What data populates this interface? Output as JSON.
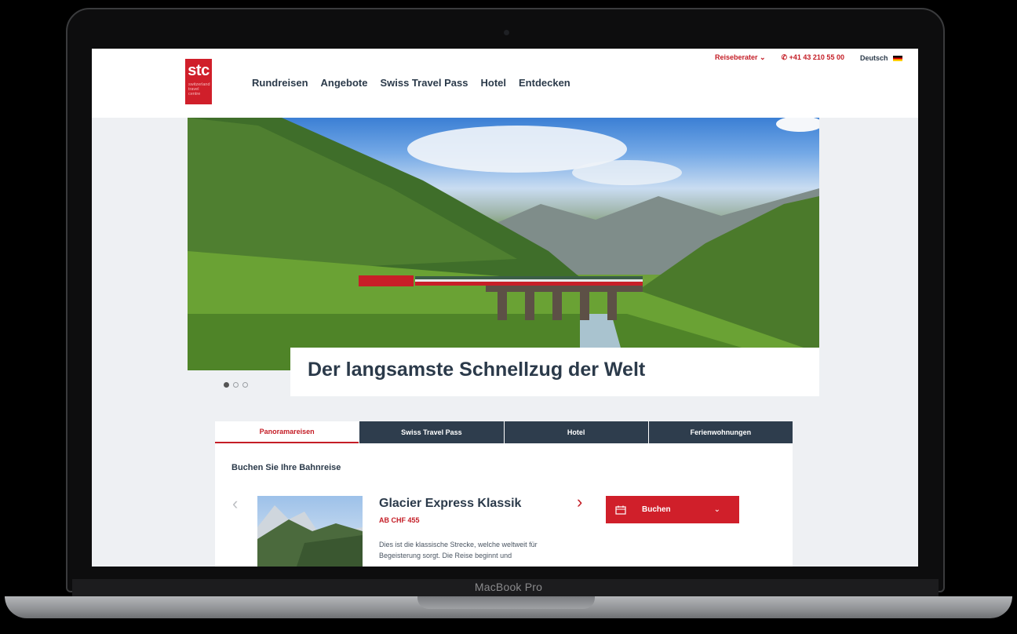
{
  "device": {
    "label": "MacBook Pro"
  },
  "header": {
    "logo": {
      "text": "stc",
      "sub": "switzerland travel centre"
    },
    "nav": [
      "Rundreisen",
      "Angebote",
      "Swiss Travel Pass",
      "Hotel",
      "Entdecken"
    ],
    "advisor": "Reiseberater",
    "phone": "+41 43 210 55 00",
    "language": "Deutsch"
  },
  "hero": {
    "caption": "Der langsamste Schnellzug der Welt",
    "slides": 3,
    "active_slide": 1
  },
  "booking": {
    "tabs": [
      "Panoramareisen",
      "Swiss Travel Pass",
      "Hotel",
      "Ferienwohnungen"
    ],
    "active_tab": "Panoramareisen",
    "heading": "Buchen Sie Ihre Bahnreise",
    "product": {
      "title": "Glacier Express Klassik",
      "price": "AB CHF 455",
      "description": "Dies ist die klassische Strecke, welche weltweit für Begeisterung sorgt. Die Reise beginnt und"
    },
    "book_button": "Buchen"
  },
  "colors": {
    "brand_red": "#d01f2a",
    "nav_dark": "#2e3d4d",
    "text_dark": "#2b3a4a"
  },
  "icons": [
    "phone-icon",
    "flag-de-icon",
    "chevron-left-icon",
    "chevron-right-icon",
    "calendar-icon",
    "chevron-down-icon"
  ]
}
